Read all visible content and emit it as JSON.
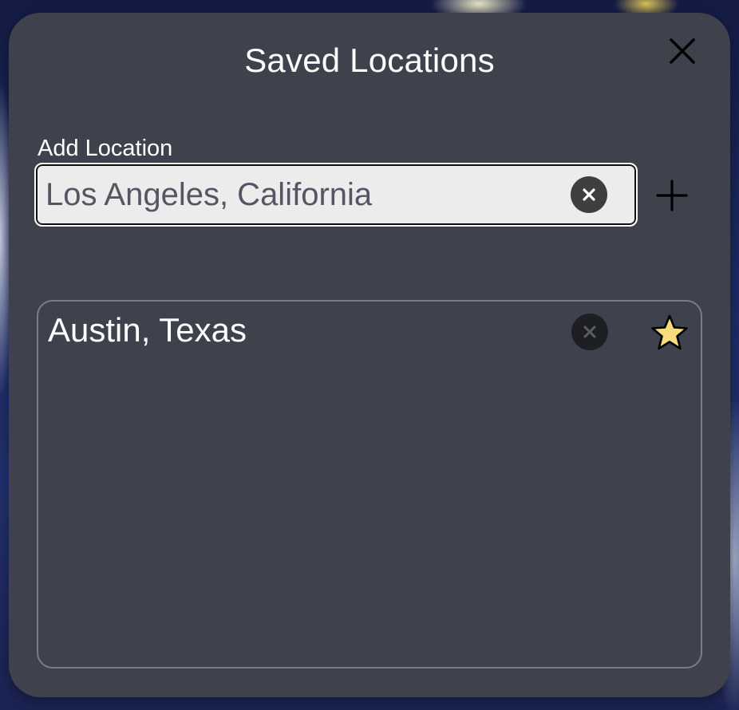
{
  "dialog": {
    "title": "Saved Locations",
    "close_icon": "close-icon"
  },
  "add_location": {
    "label": "Add Location",
    "input_value": "Los Angeles, California",
    "clear_icon": "clear-circle-icon",
    "add_icon": "plus-icon"
  },
  "saved_locations": [
    {
      "name": "Austin, Texas",
      "remove_icon": "clear-circle-icon",
      "favorite_icon": "star-icon",
      "favorite": true
    }
  ],
  "colors": {
    "dialog_bg": "#3f424d",
    "input_bg": "#ececec",
    "input_text": "#545763",
    "star_fill": "#f7dc7e",
    "text": "#ffffff"
  }
}
